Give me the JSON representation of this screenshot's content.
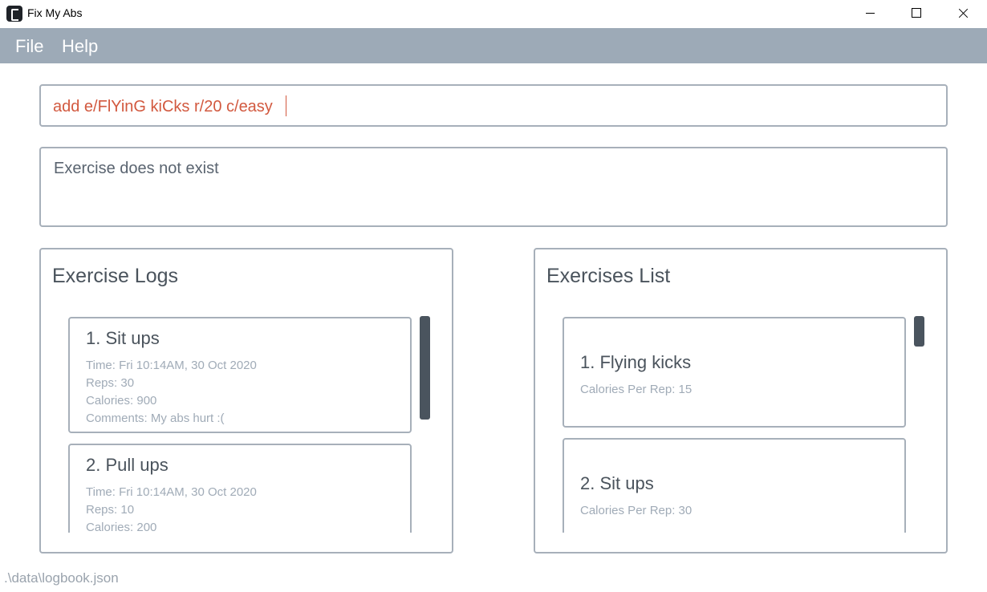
{
  "window": {
    "title": "Fix My Abs"
  },
  "menu": {
    "items": [
      "File",
      "Help"
    ]
  },
  "command": {
    "value": "add e/FlYinG kiCks r/20 c/easy"
  },
  "result": {
    "text": "Exercise does not exist"
  },
  "exercise_logs": {
    "title": "Exercise Logs",
    "entries": [
      {
        "heading": "1.  Sit ups",
        "time": "Time:  Fri 10:14AM, 30 Oct 2020",
        "reps": "Reps:  30",
        "calories": "Calories:  900",
        "comments": "Comments:  My abs hurt :("
      },
      {
        "heading": "2.  Pull ups",
        "time": "Time:  Fri 10:14AM, 30 Oct 2020",
        "reps": "Reps:  10",
        "calories": "Calories:  200"
      }
    ]
  },
  "exercises_list": {
    "title": "Exercises List",
    "entries": [
      {
        "heading": "1.  Flying kicks",
        "calories_per_rep": "Calories Per Rep:  15"
      },
      {
        "heading": "2.  Sit ups",
        "calories_per_rep": "Calories Per Rep:  30"
      }
    ]
  },
  "status": {
    "path": ".\\data\\logbook.json"
  },
  "colors": {
    "menubar": "#9daab7",
    "command_text": "#d2593f",
    "border": "#a7b0ba",
    "scrollbar": "#4a545e"
  }
}
